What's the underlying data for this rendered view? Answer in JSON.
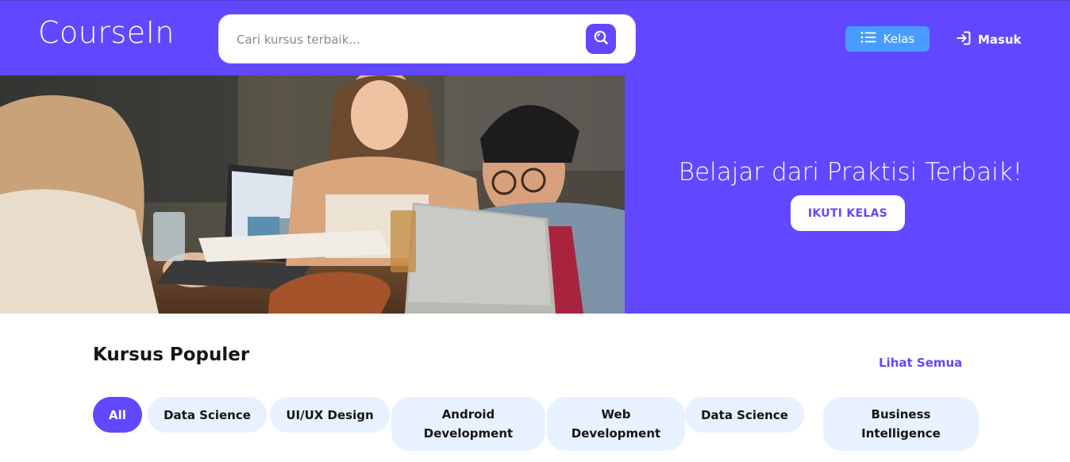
{
  "header": {
    "logo": "CourseIn",
    "search": {
      "placeholder": "Cari kursus terbaik..."
    },
    "kelas_label": "Kelas",
    "masuk_label": "Masuk"
  },
  "hero": {
    "title": "Belajar dari Praktisi Terbaik!",
    "cta_label": "IKUTI KELAS"
  },
  "popular": {
    "title": "Kursus Populer",
    "see_all": "Lihat Semua",
    "chips": [
      "All",
      "Data Science",
      "UI/UX Design",
      "Android Development",
      "Web Development",
      "Data Science",
      "Business Intelligence"
    ],
    "active_index": 0
  },
  "colors": {
    "primary": "#6148FF",
    "accent_blue": "#489CFF",
    "chip_bg": "#E8F1FF"
  }
}
